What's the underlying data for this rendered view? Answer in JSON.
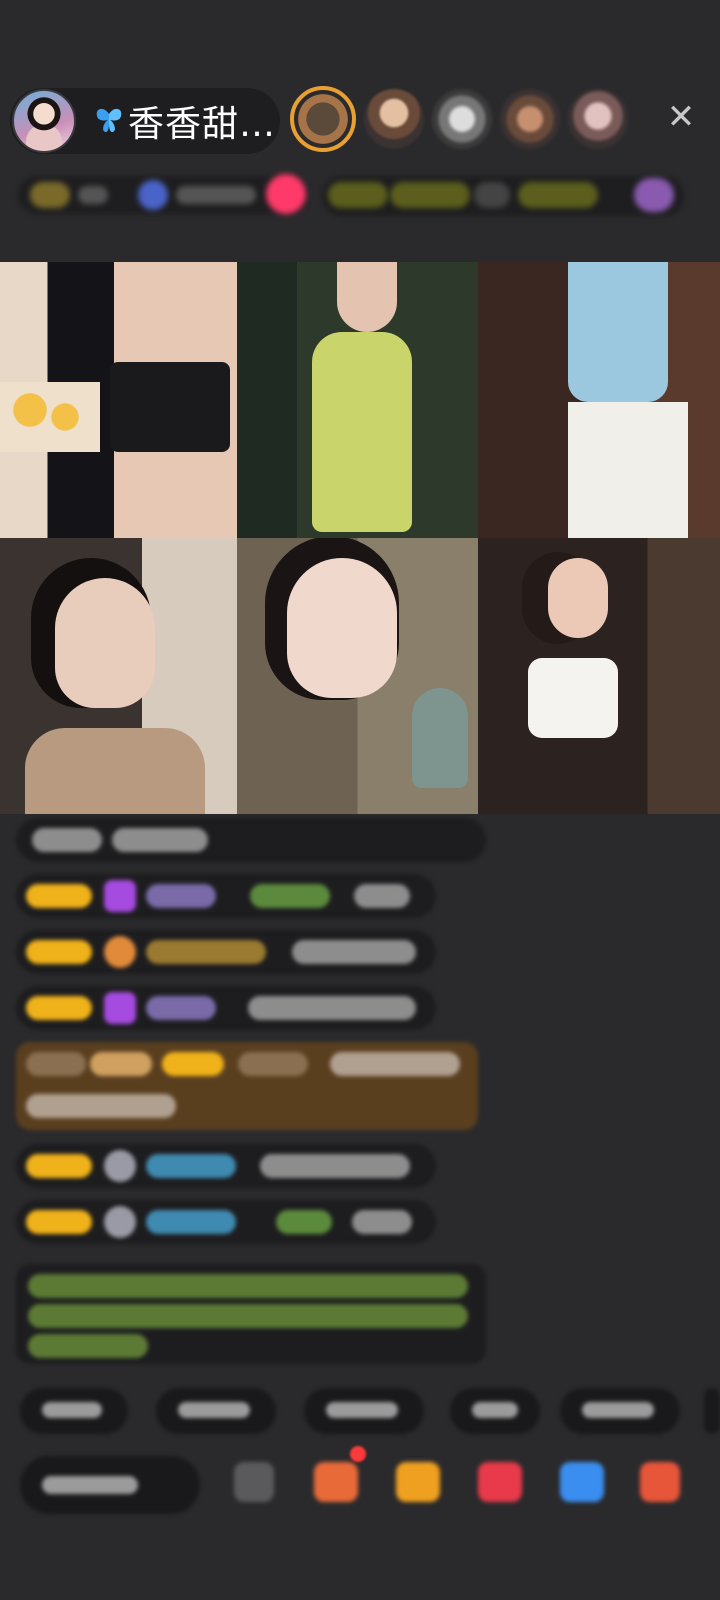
{
  "header": {
    "host_name": "香香甜…"
  },
  "header_icons": {
    "badge_icon": "butterfly-icon",
    "close_icon": "close-icon",
    "viewer_count": 5
  },
  "video_grid": {
    "tiles": 6
  },
  "chat": {
    "rows": 9
  },
  "colors": {
    "background": "#2a2a2c",
    "badge_yellow": "#f0b21a",
    "gift_panel": "#5a3f1f",
    "notice_green": "#86b24f"
  }
}
